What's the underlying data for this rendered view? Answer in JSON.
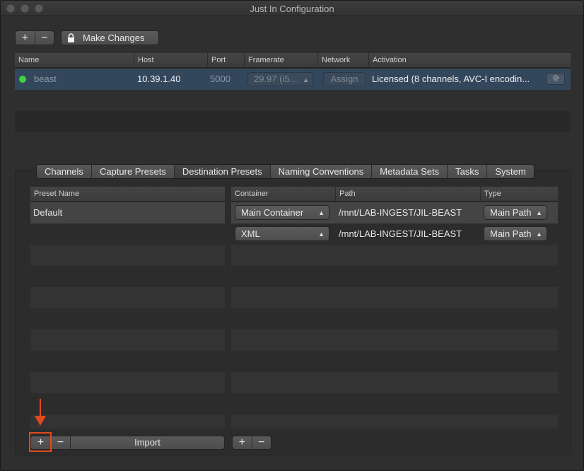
{
  "window": {
    "title": "Just In Configuration"
  },
  "toolbar": {
    "add_label": "+",
    "remove_label": "−",
    "make_changes_label": "Make Changes"
  },
  "devices": {
    "columns": [
      "Name",
      "Host",
      "Port",
      "Framerate",
      "Network",
      "Activation"
    ],
    "rows": [
      {
        "status_color": "#3fd23f",
        "name": "beast",
        "host": "10.39.1.40",
        "port": "5000",
        "framerate": "29.97 (i5...",
        "network": "Assign",
        "activation": "Licensed (8 channels, AVC-I encodin..."
      }
    ]
  },
  "tabs": [
    {
      "label": "Channels",
      "active": false
    },
    {
      "label": "Capture Presets",
      "active": false
    },
    {
      "label": "Destination Presets",
      "active": true
    },
    {
      "label": "Naming Conventions",
      "active": false
    },
    {
      "label": "Metadata Sets",
      "active": false
    },
    {
      "label": "Tasks",
      "active": false
    },
    {
      "label": "System",
      "active": false
    }
  ],
  "presets": {
    "header": "Preset Name",
    "items": [
      "Default"
    ]
  },
  "destinations": {
    "columns": [
      "Container",
      "Path",
      "Type"
    ],
    "rows": [
      {
        "container": "Main Container",
        "path": "/mnt/LAB-INGEST/JIL-BEAST",
        "type": "Main Path"
      },
      {
        "container": "XML",
        "path": "/mnt/LAB-INGEST/JIL-BEAST",
        "type": "Main Path"
      }
    ]
  },
  "bottom": {
    "add_label": "+",
    "remove_label": "−",
    "import_label": "Import",
    "dest_add_label": "+",
    "dest_remove_label": "−"
  },
  "annotation": {
    "color": "#e24a1c"
  }
}
